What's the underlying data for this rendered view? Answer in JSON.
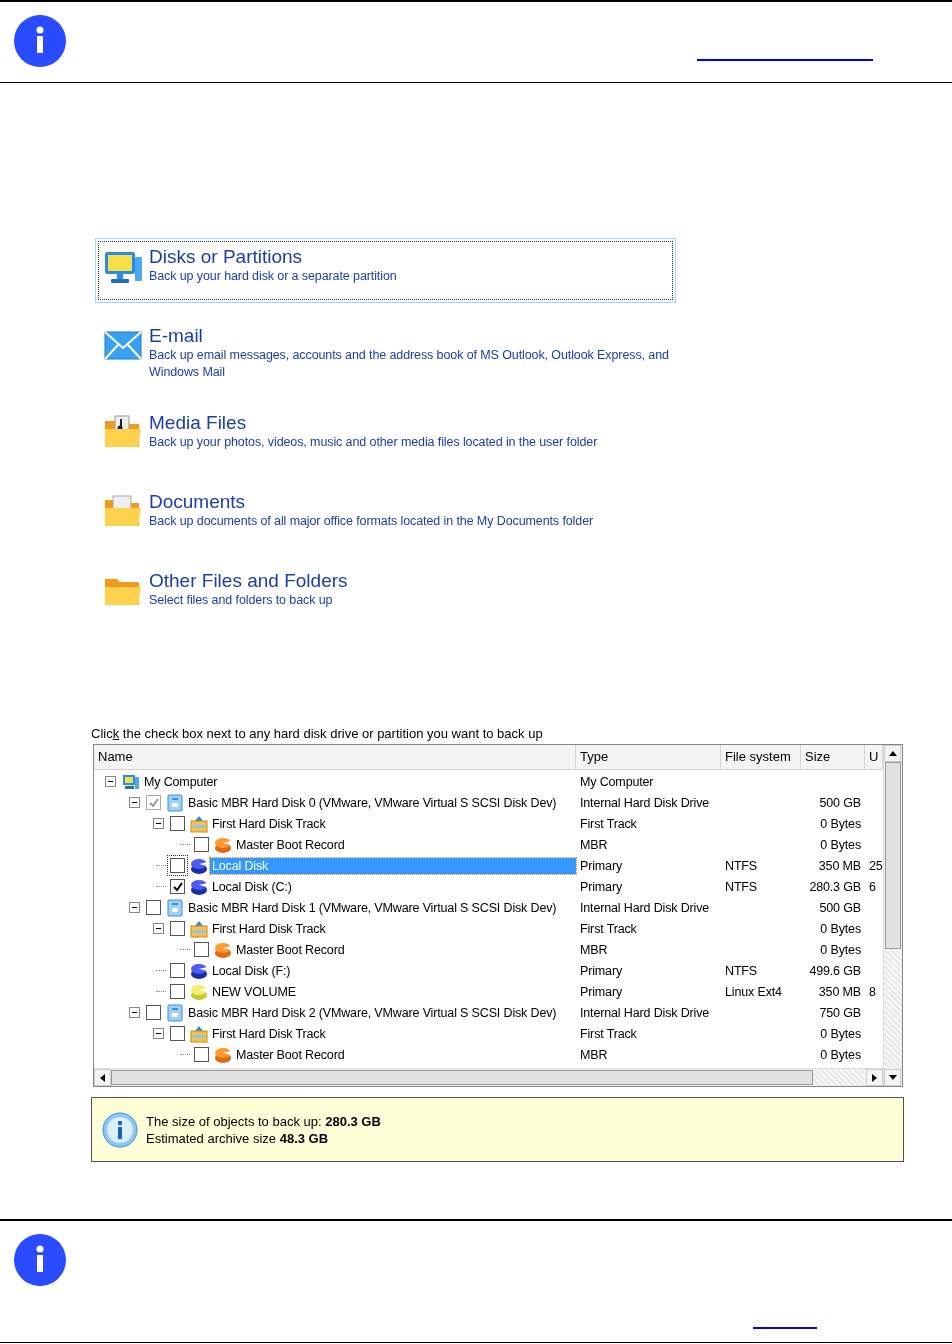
{
  "top_note": {
    "kind": "info",
    "link": true
  },
  "backup_options": [
    {
      "kind": "disks",
      "title": "Disks or Partitions",
      "description": "Back up your hard disk or a separate partition",
      "selected": true
    },
    {
      "kind": "email",
      "title": "E-mail",
      "description": "Back up email messages, accounts and the address book of MS Outlook, Outlook Express, and Windows Mail",
      "selected": false
    },
    {
      "kind": "media",
      "title": "Media Files",
      "description": "Back up your photos, videos, music and other media files located in the user folder",
      "selected": false
    },
    {
      "kind": "documents",
      "title": "Documents",
      "description": "Back up documents of all major office formats located in the My Documents folder",
      "selected": false
    },
    {
      "kind": "folders",
      "title": "Other Files and Folders",
      "description": "Select files and folders to back up",
      "selected": false
    }
  ],
  "tree_label": {
    "text": "Click the check box next to any hard disk drive or partition you want to back up"
  },
  "tree": {
    "columns": [
      "Name",
      "Type",
      "File system",
      "Size",
      "U"
    ],
    "rows": [
      {
        "kind": "computer",
        "name": "My Computer",
        "type": "My Computer",
        "expanded": true,
        "selected": false,
        "children": [
          {
            "kind": "disk",
            "name": "Basic MBR Hard Disk 0 (VMware, VMware Virtual S SCSI Disk Dev)",
            "type": "Internal Hard Disk Drive",
            "size": "500 GB",
            "checked": true,
            "disabled": true,
            "expanded": true,
            "selected": false,
            "children": [
              {
                "kind": "track",
                "name": "First Hard Disk Track",
                "type": "First Track",
                "size": "0 Bytes",
                "checked": false,
                "disabled": false,
                "expanded": true,
                "selected": false,
                "children": [
                  {
                    "kind": "mbr",
                    "name": "Master Boot Record",
                    "type": "MBR",
                    "size": "0 Bytes",
                    "checked": false,
                    "disabled": false,
                    "selected": false
                  }
                ]
              },
              {
                "kind": "partition",
                "name": "Local Disk",
                "type": "Primary",
                "file_system": "NTFS",
                "size": "350 MB",
                "used": "25",
                "checked": false,
                "disabled": false,
                "selected": true
              },
              {
                "kind": "partition",
                "name": "Local Disk (C:)",
                "type": "Primary",
                "file_system": "NTFS",
                "size": "280.3 GB",
                "used": "6",
                "checked": true,
                "disabled": false,
                "selected": false
              }
            ]
          },
          {
            "kind": "disk",
            "name": "Basic MBR Hard Disk 1 (VMware, VMware Virtual S SCSI Disk Dev)",
            "type": "Internal Hard Disk Drive",
            "size": "500 GB",
            "checked": false,
            "disabled": false,
            "expanded": true,
            "selected": false,
            "children": [
              {
                "kind": "track",
                "name": "First Hard Disk Track",
                "type": "First Track",
                "size": "0 Bytes",
                "checked": false,
                "disabled": false,
                "expanded": true,
                "selected": false,
                "children": [
                  {
                    "kind": "mbr",
                    "name": "Master Boot Record",
                    "type": "MBR",
                    "size": "0 Bytes",
                    "checked": false,
                    "disabled": false,
                    "selected": false
                  }
                ]
              },
              {
                "kind": "partition",
                "name": "Local Disk (F:)",
                "type": "Primary",
                "file_system": "NTFS",
                "size": "499.6 GB",
                "checked": false,
                "disabled": false,
                "selected": false
              },
              {
                "kind": "volume",
                "name": "NEW VOLUME",
                "type": "Primary",
                "file_system": "Linux Ext4",
                "size": "350 MB",
                "used": "8",
                "checked": false,
                "disabled": false,
                "selected": false
              }
            ]
          },
          {
            "kind": "disk",
            "name": "Basic MBR Hard Disk 2 (VMware, VMware Virtual S SCSI Disk Dev)",
            "type": "Internal Hard Disk Drive",
            "size": "750 GB",
            "checked": false,
            "disabled": false,
            "expanded": true,
            "selected": false,
            "children": [
              {
                "kind": "track",
                "name": "First Hard Disk Track",
                "type": "First Track",
                "size": "0 Bytes",
                "checked": false,
                "disabled": false,
                "expanded": true,
                "selected": false,
                "children": [
                  {
                    "kind": "mbr",
                    "name": "Master Boot Record",
                    "type": "MBR",
                    "size": "0 Bytes",
                    "checked": false,
                    "disabled": false,
                    "selected": false
                  }
                ]
              }
            ]
          }
        ]
      }
    ]
  },
  "summary": {
    "lines": [
      "The size of objects to back up: **280.3 GB**",
      "Estimated archive size **48.3 GB**"
    ]
  },
  "bottom_note": {
    "kind": "info",
    "link": true
  }
}
